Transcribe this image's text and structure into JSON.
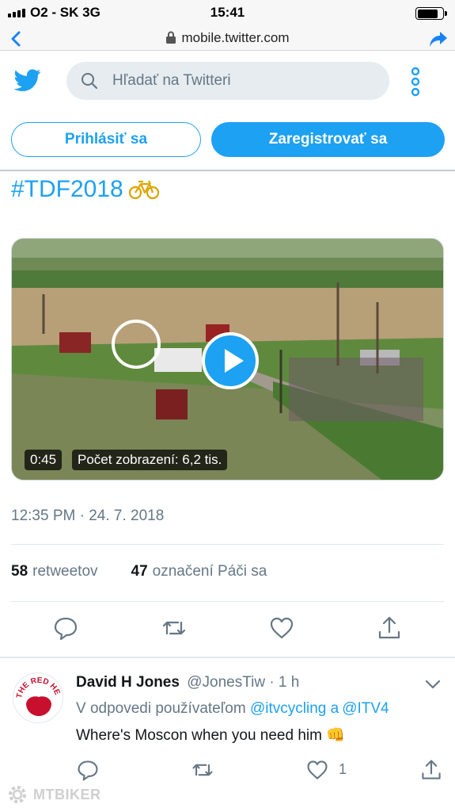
{
  "status": {
    "carrier": "O2 - SK   3G",
    "time": "15:41",
    "battery_level": 0.82
  },
  "browser": {
    "url": "mobile.twitter.com"
  },
  "header": {
    "search_placeholder": "Hľadať na Twitteri"
  },
  "auth": {
    "login_label": "Prihlásiť sa",
    "signup_label": "Zaregistrovať sa"
  },
  "tweet": {
    "hashtag": "#TDF2018",
    "emoji": "🚲",
    "video": {
      "duration": "0:45",
      "views": "Počet zobrazení: 6,2 tis."
    },
    "timestamp": "12:35 PM · 24. 7. 2018",
    "retweets_count": "58",
    "retweets_label": "retweetov",
    "likes_count": "47",
    "likes_label": "označení Páči sa"
  },
  "reply": {
    "name": "David H Jones",
    "handle": "@JonesTiw · 1 h",
    "reply_prefix": "V odpovedi používateľom",
    "mention1": "@itvcycling",
    "conj": "a",
    "mention2": "@ITV4",
    "text": "Where's Moscon when you need him",
    "text_emoji": "👊",
    "like_count": "1",
    "avatar_text": "THE RED HE"
  },
  "watermark": "MTBIKER",
  "colors": {
    "twitter_blue": "#1da1f2",
    "gray_text": "#657786",
    "search_bg": "#e6ecf0"
  }
}
